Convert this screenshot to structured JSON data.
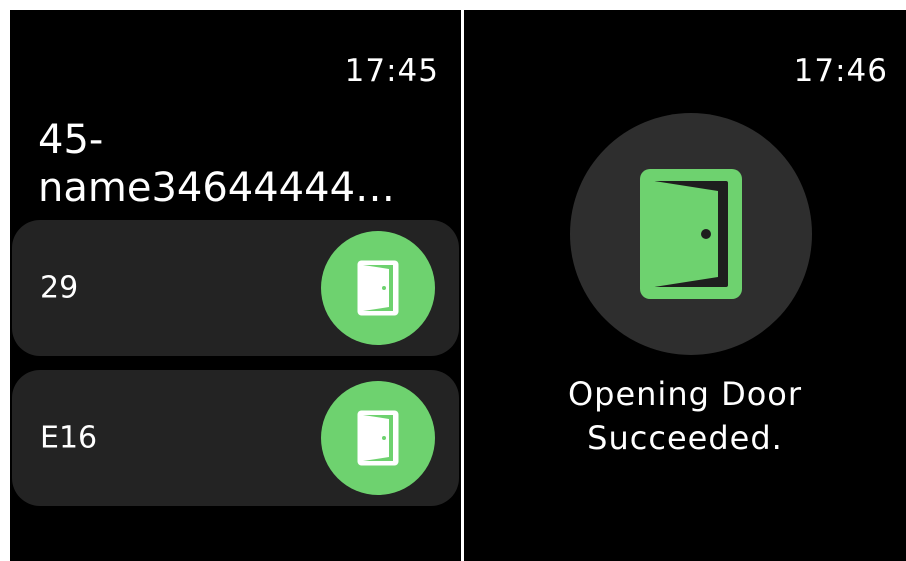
{
  "left_screen": {
    "time": "17:45",
    "title_line1": "45-",
    "title_line2": "name34644444…",
    "doors": [
      {
        "name": "29",
        "button_icon": "door-icon"
      },
      {
        "name": "E16",
        "button_icon": "door-icon"
      }
    ]
  },
  "right_screen": {
    "time": "17:46",
    "result_icon": "door-icon",
    "status_line1": "Opening Door",
    "status_line2": "Succeeded."
  },
  "colors": {
    "background": "#000000",
    "card": "#232323",
    "accent_green": "#6ed26f",
    "result_circle": "#2e2e2e"
  }
}
